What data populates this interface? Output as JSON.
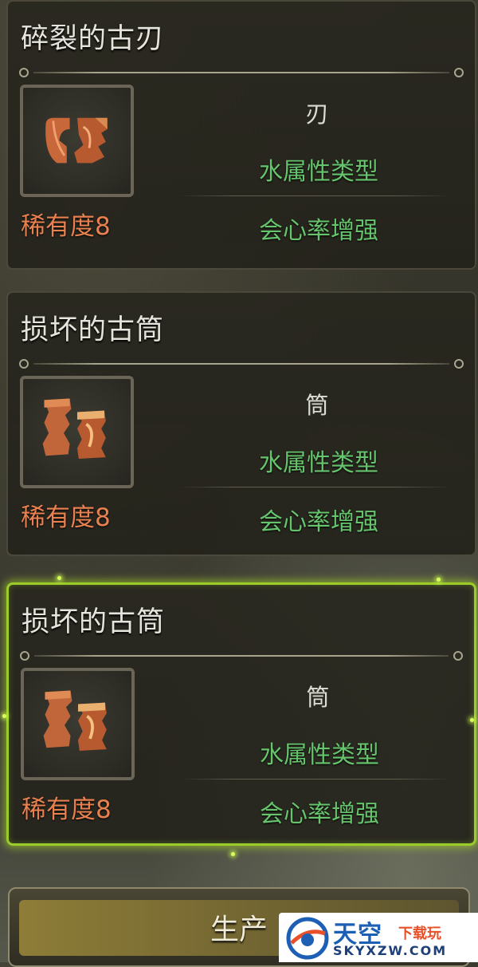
{
  "items": [
    {
      "name": "碎裂的古刃",
      "rarity": "稀有度8",
      "type": "刃",
      "attribute": "水属性类型",
      "effect": "会心率增强",
      "icon": "broken-blade-icon",
      "selected": false
    },
    {
      "name": "损坏的古筒",
      "rarity": "稀有度8",
      "type": "筒",
      "attribute": "水属性类型",
      "effect": "会心率增强",
      "icon": "broken-tube-icon",
      "selected": false
    },
    {
      "name": "损坏的古筒",
      "rarity": "稀有度8",
      "type": "筒",
      "attribute": "水属性类型",
      "effect": "会心率增强",
      "icon": "broken-tube-icon",
      "selected": true
    }
  ],
  "produce_button": {
    "label": "生产"
  },
  "watermark": {
    "title": "天空",
    "subtitle": "下载玩",
    "url": "SKYXZW.COM"
  },
  "colors": {
    "rarity": "#e8804f",
    "attribute": "#66c46d",
    "selected_border": "#9bcc2a"
  }
}
